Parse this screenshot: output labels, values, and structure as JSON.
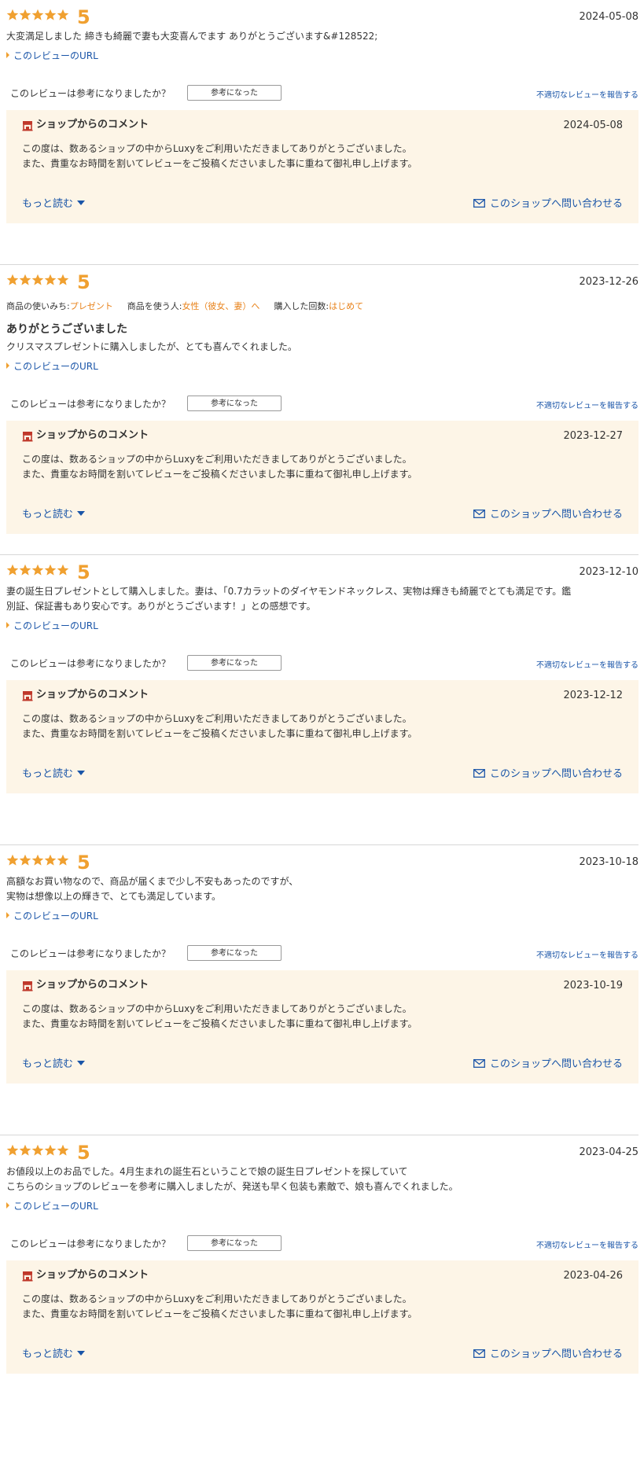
{
  "labels": {
    "url_link": "このレビューのURL",
    "helpful_question": "このレビューは参考になりましたか？",
    "helpful_button": "参考になった",
    "report_link": "不適切なレビューを報告する",
    "shop_comment_title": "ショップからのコメント",
    "read_more": "もっと読む",
    "contact_shop": "このショップへ問い合わせる"
  },
  "colors": {
    "star": "#f0a030",
    "star_empty": "#dddddd",
    "attr_value": "#e8821a",
    "link": "#1a55a8",
    "shop_box_bg": "#fdf5e7",
    "shop_icon": "#c0392b"
  },
  "icons": {
    "star": "star-icon",
    "url_marker": "triangle-right-icon",
    "shop": "shop-icon",
    "read_more": "chevron-down-icon",
    "contact": "mail-icon"
  },
  "reviews": [
    {
      "rating": "5",
      "stars_filled": 5,
      "date": "2024-05-08",
      "attributes": [],
      "title": "",
      "body": [
        "大変満足しました 締きも綺麗で妻も大変喜んでます ありがとうございます&#128522;"
      ],
      "shop_comment": {
        "date": "2024-05-08",
        "body": [
          "この度は、数あるショップの中からLuxyをご利用いただきましてありがとうございました。",
          "また、貴重なお時間を割いてレビューをご投稿くださいました事に重ねて御礼申し上げます。"
        ]
      }
    },
    {
      "rating": "5",
      "stars_filled": 5,
      "date": "2023-12-26",
      "attributes": [
        {
          "label": "商品の使いみち:",
          "value": "プレゼント"
        },
        {
          "label": "商品を使う人:",
          "value": "女性（彼女、妻）へ"
        },
        {
          "label": "購入した回数:",
          "value": "はじめて"
        }
      ],
      "title": "ありがとうございました",
      "body": [
        "クリスマスプレゼントに購入しましたが、とても喜んでくれました。"
      ],
      "shop_comment": {
        "date": "2023-12-27",
        "body": [
          "この度は、数あるショップの中からLuxyをご利用いただきましてありがとうございました。",
          "また、貴重なお時間を割いてレビューをご投稿くださいました事に重ねて御礼申し上げます。"
        ]
      }
    },
    {
      "rating": "5",
      "stars_filled": 5,
      "date": "2023-12-10",
      "attributes": [],
      "title": "",
      "body": [
        "妻の誕生日プレゼントとして購入しました。妻は、「0.7カラットのダイヤモンドネックレス、実物は輝きも綺麗でとても満足です。鑑",
        "別証、保証書もあり安心です。ありがとうございます！」との感想です。"
      ],
      "shop_comment": {
        "date": "2023-12-12",
        "body": [
          "この度は、数あるショップの中からLuxyをご利用いただきましてありがとうございました。",
          "また、貴重なお時間を割いてレビューをご投稿くださいました事に重ねて御礼申し上げます。"
        ]
      }
    },
    {
      "rating": "5",
      "stars_filled": 5,
      "date": "2023-10-18",
      "attributes": [],
      "title": "",
      "body": [
        "高額なお買い物なので、商品が届くまで少し不安もあったのですが、",
        "実物は想像以上の輝きで、とても満足しています。"
      ],
      "shop_comment": {
        "date": "2023-10-19",
        "body": [
          "この度は、数あるショップの中からLuxyをご利用いただきましてありがとうございました。",
          "また、貴重なお時間を割いてレビューをご投稿くださいました事に重ねて御礼申し上げます。"
        ]
      }
    },
    {
      "rating": "5",
      "stars_filled": 5,
      "date": "2023-04-25",
      "attributes": [],
      "title": "",
      "body": [
        "お値段以上のお品でした。4月生まれの誕生石ということで娘の誕生日プレゼントを探していて",
        "こちらのショップのレビューを参考に購入しましたが、発送も早く包装も素敵で、娘も喜んでくれました。"
      ],
      "shop_comment": {
        "date": "2023-04-26",
        "body": [
          "この度は、数あるショップの中からLuxyをご利用いただきましてありがとうございました。",
          "また、貴重なお時間を割いてレビューをご投稿くださいました事に重ねて御礼申し上げます。"
        ]
      }
    }
  ]
}
